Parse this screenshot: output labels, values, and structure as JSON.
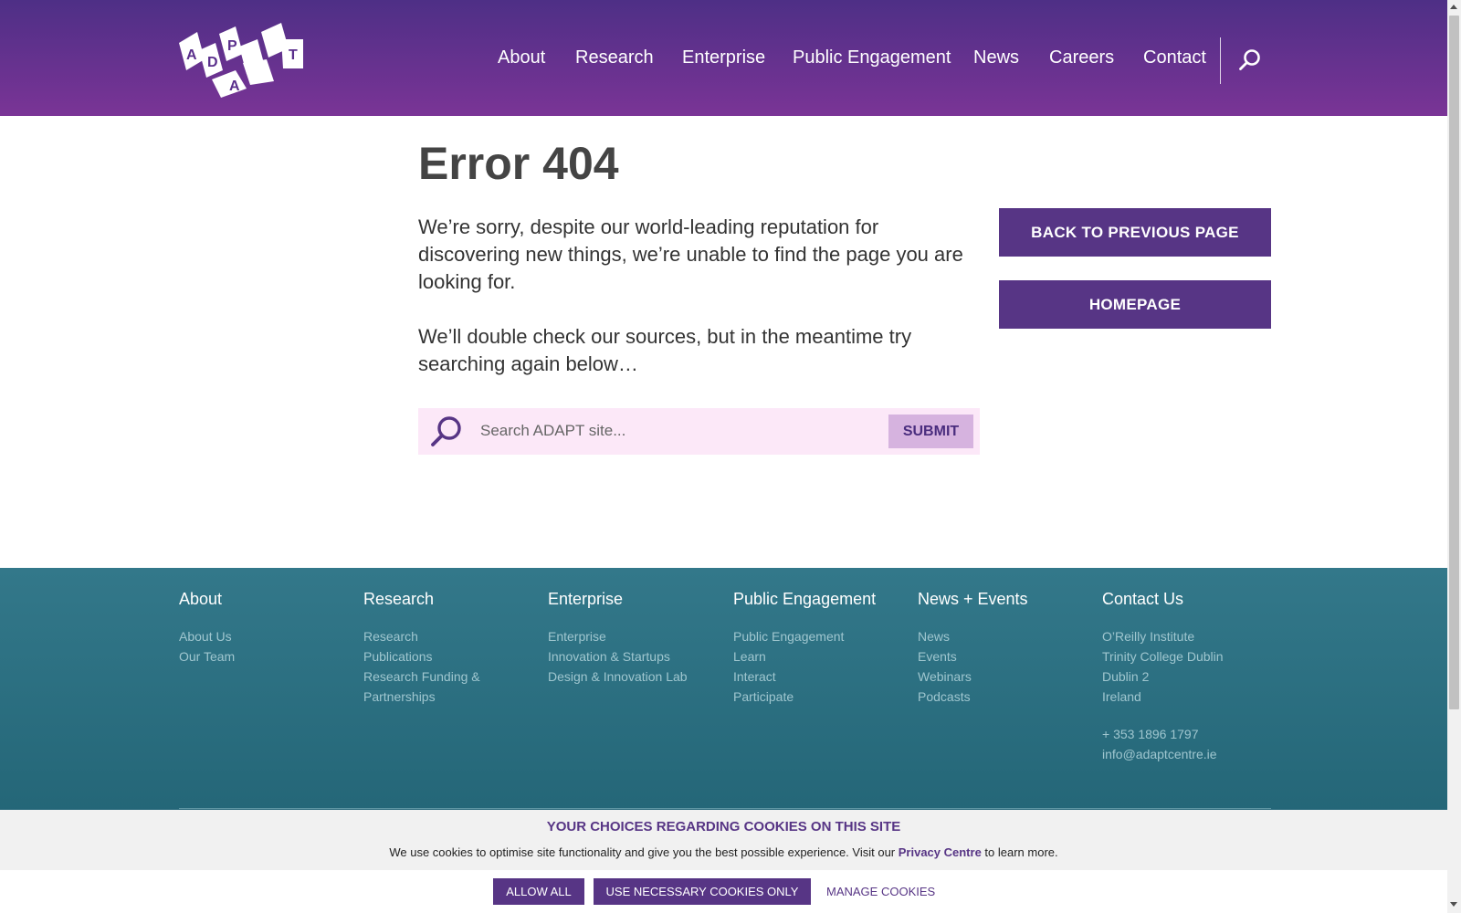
{
  "header": {
    "logo_letters": [
      "A",
      "D",
      "P",
      "A",
      "T"
    ],
    "nav": [
      "About",
      "Research",
      "Enterprise",
      "Public Engagement",
      "News",
      "Careers",
      "Contact"
    ],
    "search_icon": "search-icon"
  },
  "main": {
    "title": "Error 404",
    "paragraph1": "We’re sorry, despite our world-leading reputation for discovering new things, we’re unable to find the page you are looking for.",
    "paragraph2": "We’ll double check our sources, but in the meantime try searching again below…",
    "search": {
      "placeholder": "Search ADAPT site...",
      "submit": "SUBMIT"
    },
    "back_button": "BACK TO PREVIOUS PAGE",
    "home_button": "HOMEPAGE"
  },
  "footer": {
    "columns": [
      {
        "heading": "About",
        "links": [
          "About Us",
          "Our Team"
        ]
      },
      {
        "heading": "Research",
        "links": [
          "Research",
          "Publications",
          "Research Funding & Partnerships"
        ]
      },
      {
        "heading": "Enterprise",
        "links": [
          "Enterprise",
          "Innovation & Startups",
          "Design & Innovation Lab"
        ]
      },
      {
        "heading": "Public Engagement",
        "links": [
          "Public Engagement",
          "Learn",
          "Interact",
          "Participate"
        ]
      },
      {
        "heading": "News + Events",
        "links": [
          "News",
          "Events",
          "Webinars",
          "Podcasts"
        ]
      },
      {
        "heading": "Contact Us",
        "links": [
          "O’Reilly Institute",
          "Trinity College Dublin",
          "Dublin 2",
          "Ireland"
        ],
        "phone": "+ 353 1896 1797",
        "email": "info@adaptcentre.ie"
      }
    ]
  },
  "cookie": {
    "title": "YOUR CHOICES REGARDING COOKIES ON THIS SITE",
    "text_before": "We use cookies to optimise site functionality and give you the best possible experience. Visit our ",
    "link": "Privacy Centre",
    "text_after": " to learn more.",
    "allow_all": "ALLOW ALL",
    "necessary_only": "USE NECESSARY COOKIES ONLY",
    "manage": "MANAGE COOKIES"
  },
  "colors": {
    "header_top": "#4e2f86",
    "header_bottom": "#7a3496",
    "button_purple": "#573585",
    "search_bg": "#fce8f8",
    "footer_teal": "#2a6d7e"
  }
}
